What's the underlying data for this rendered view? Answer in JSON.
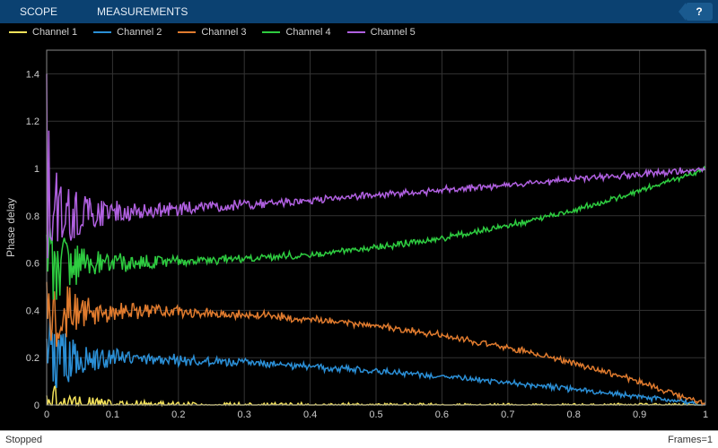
{
  "menubar": {
    "tabs": [
      "SCOPE",
      "MEASUREMENTS"
    ],
    "help_tooltip": "?"
  },
  "legend": {
    "items": [
      {
        "label": "Channel 1",
        "color": "#f5e35a"
      },
      {
        "label": "Channel 2",
        "color": "#2b8fd6"
      },
      {
        "label": "Channel 3",
        "color": "#e07b2e"
      },
      {
        "label": "Channel 4",
        "color": "#2ecc40"
      },
      {
        "label": "Channel 5",
        "color": "#b060e0"
      }
    ]
  },
  "status": {
    "left": "Stopped",
    "right": "Frames=1"
  },
  "chart_data": {
    "type": "line",
    "ylabel": "Phase delay",
    "xlim": [
      0,
      1
    ],
    "ylim": [
      0,
      1.5
    ],
    "xticks": [
      0,
      0.1,
      0.2,
      0.3,
      0.4,
      0.5,
      0.6,
      0.7,
      0.8,
      0.9,
      1
    ],
    "yticks": [
      0,
      0.2,
      0.4,
      0.6,
      0.8,
      1,
      1.2,
      1.4
    ],
    "series": [
      {
        "name": "Channel 1",
        "color": "#f5e35a",
        "base": 0.0,
        "end": 0.0,
        "curve": 0.0,
        "noise_amp": 0.012,
        "spike": 0.02
      },
      {
        "name": "Channel 2",
        "color": "#2b8fd6",
        "base": 0.2,
        "end": 0.0,
        "curve": -1.8,
        "noise_amp": 0.02,
        "spike": 0.04
      },
      {
        "name": "Channel 3",
        "color": "#e07b2e",
        "base": 0.4,
        "end": 0.0,
        "curve": -2.6,
        "noise_amp": 0.022,
        "spike": 0.06
      },
      {
        "name": "Channel 4",
        "color": "#2ecc40",
        "base": 0.6,
        "end": 1.0,
        "curve": 2.6,
        "noise_amp": 0.022,
        "spike": 0.06
      },
      {
        "name": "Channel 5",
        "color": "#b060e0",
        "base": 0.8,
        "end": 1.0,
        "curve": 1.2,
        "noise_amp": 0.024,
        "spike": 0.3
      }
    ]
  }
}
